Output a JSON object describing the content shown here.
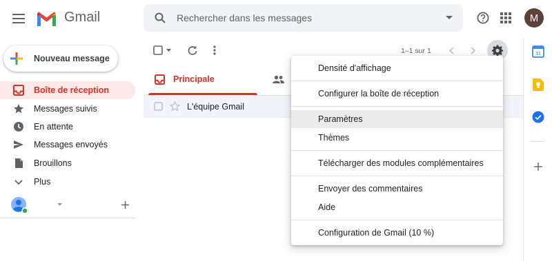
{
  "app": {
    "name": "Gmail",
    "brand_colors": {
      "red": "#d93025",
      "blue": "#4285f4",
      "green": "#34a853",
      "yellow": "#fbbc04"
    }
  },
  "header": {
    "search_placeholder": "Rechercher dans les messages",
    "avatar_initial": "M",
    "icons": [
      "menu-icon",
      "search-icon",
      "search-options-icon",
      "help-icon",
      "apps-icon"
    ]
  },
  "compose": {
    "label": "Nouveau message"
  },
  "sidebar": {
    "items": [
      {
        "label": "Boîte de réception",
        "icon": "inbox-icon",
        "active": true
      },
      {
        "label": "Messages suivis",
        "icon": "star-icon",
        "active": false
      },
      {
        "label": "En attente",
        "icon": "clock-icon",
        "active": false
      },
      {
        "label": "Messages envoyés",
        "icon": "send-icon",
        "active": false
      },
      {
        "label": "Brouillons",
        "icon": "draft-icon",
        "active": false
      },
      {
        "label": "Plus",
        "icon": "chevron-down-icon",
        "active": false
      }
    ]
  },
  "toolbar": {
    "pager": "1–1 sur 1"
  },
  "tabs": [
    {
      "label": "Principale",
      "icon": "inbox-icon",
      "active": true
    }
  ],
  "mails": [
    {
      "sender": "L'équipe Gmail",
      "starred": false
    }
  ],
  "settings_menu": {
    "groups": [
      [
        "Densité d'affichage"
      ],
      [
        "Configurer la boîte de réception"
      ],
      [
        "Paramètres",
        "Thèmes"
      ],
      [
        "Télécharger des modules complémentaires"
      ],
      [
        "Envoyer des commentaires",
        "Aide"
      ],
      [
        "Configuration de Gmail (10 %)"
      ]
    ],
    "hovered": "Paramètres"
  }
}
